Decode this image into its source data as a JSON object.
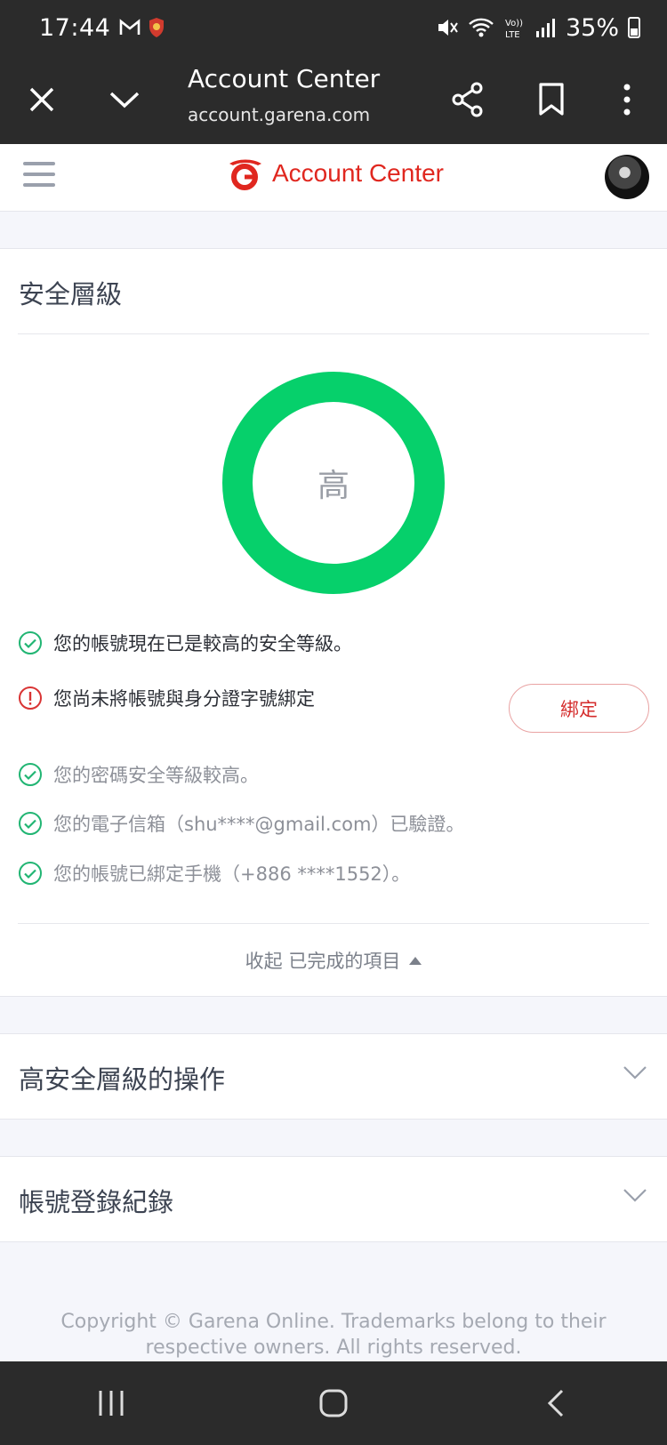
{
  "status_bar": {
    "time": "17:44",
    "battery": "35%"
  },
  "toolbar": {
    "title": "Account Center",
    "url": "account.garena.com"
  },
  "site_header": {
    "logo_text": "Account Center"
  },
  "security": {
    "title": "安全層級",
    "level": "高",
    "items": [
      {
        "text": "您的帳號現在已是較高的安全等級。",
        "status": "ok"
      },
      {
        "text": "您尚未將帳號與身分證字號綁定",
        "status": "warning",
        "action_label": "綁定"
      },
      {
        "text": "您的密碼安全等級較高。",
        "status": "ok"
      },
      {
        "text": "您的電子信箱（shu****@gmail.com）已驗證。",
        "status": "ok"
      },
      {
        "text": "您的帳號已綁定手機（+886 ****1552）。",
        "status": "ok"
      }
    ],
    "collapse_label": "收起 已完成的項目"
  },
  "sections": [
    {
      "title": "高安全層級的操作"
    },
    {
      "title": "帳號登錄紀錄"
    }
  ],
  "footer": {
    "line1": "Copyright © Garena Online. Trademarks belong to their",
    "line2": "respective owners. All rights reserved."
  },
  "colors": {
    "ok": "#21b573",
    "warning": "#d93434",
    "ring": "#06d06b",
    "brand": "#e0271f",
    "chrome": "#2b2b2b"
  }
}
